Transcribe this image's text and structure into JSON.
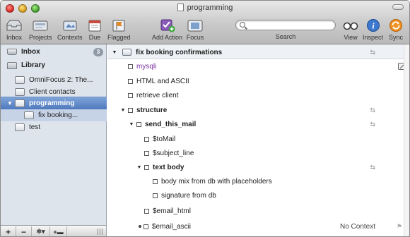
{
  "window": {
    "title": "programming"
  },
  "toolbar": {
    "inbox": "Inbox",
    "projects": "Projects",
    "contexts": "Contexts",
    "due": "Due",
    "flagged": "Flagged",
    "add_action": "Add Action",
    "focus": "Focus",
    "search_label": "Search",
    "search_placeholder": "",
    "view": "View",
    "inspect": "Inspect",
    "sync": "Sync"
  },
  "sidebar": {
    "inbox": {
      "label": "Inbox",
      "count": "3"
    },
    "library": {
      "label": "Library"
    },
    "items": [
      {
        "label": "OmniFocus 2: The..."
      },
      {
        "label": "Client contacts"
      },
      {
        "label": "programming"
      },
      {
        "label": "fix booking..."
      },
      {
        "label": "test"
      }
    ],
    "buttons": {
      "add": "+",
      "remove": "−",
      "gear": "✲▾",
      "add_group": "+▬"
    }
  },
  "outline": {
    "header": "fix booking confirmations",
    "rows": [
      {
        "label": "mysqli"
      },
      {
        "label": "HTML and ASCII"
      },
      {
        "label": "retrieve client"
      },
      {
        "label": "structure"
      },
      {
        "label": "send_this_mail"
      },
      {
        "label": "$toMail"
      },
      {
        "label": "$subject_line"
      },
      {
        "label": "text body"
      },
      {
        "label": "body mix from db with placeholders"
      },
      {
        "label": "signature from db"
      },
      {
        "label": "$email_html"
      },
      {
        "label": "$email_ascii"
      }
    ],
    "context_text": "No Context"
  },
  "colors": {
    "selection": "#5a82c2",
    "sidebar_bg": "#dde4ec",
    "accent_purple": "#7b2fa0",
    "sync_orange": "#f0901e"
  }
}
